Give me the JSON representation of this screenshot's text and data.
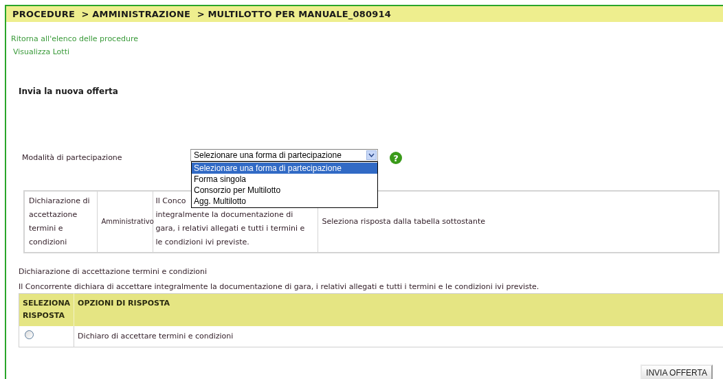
{
  "breadcrumb": "PROCEDURE  > AMMINISTRAZIONE  > MULTILOTTO PER MANUALE_080914",
  "links": [
    "Ritorna all'elenco delle procedure",
    "Visualizza Lotti"
  ],
  "section_title": "Invia la nuova offerta",
  "participation": {
    "label": "Modalità di partecipazione",
    "help": "?",
    "value": "Selezionare una forma di partecipazione",
    "expanded": true,
    "options": [
      {
        "label": "Selezionare una forma di partecipazione",
        "selected": true
      },
      {
        "label": "Forma singola",
        "selected": false
      },
      {
        "label": "Consorzio per Multilotto",
        "selected": false
      },
      {
        "label": "Agg. Multilotto",
        "selected": false
      }
    ]
  },
  "requirements_table": {
    "rows": [
      {
        "cells": [
          {
            "text": "Dichiarazione di accettazione termini e condizioni"
          },
          {
            "text": "Amministrativo"
          },
          {
            "lines": [
              "Il Conco",
              "integralmente la documentazione di",
              "gara, i relativi allegati e tutti i termini e",
              "le condizioni ivi previste."
            ]
          },
          {
            "text": "Seleziona risposta dalla tabella sottostante"
          }
        ]
      }
    ]
  },
  "declaration": {
    "title": "Dichiarazione di accettazione termini e condizioni",
    "description": "Il Concorrente dichiara di accettare integralmente la documentazione di gara, i relativi allegati e tutti i termini e le condizioni ivi previste."
  },
  "answers_table": {
    "columns": [
      "SELEZIONA RISPOSTA",
      "OPZIONI DI RISPOSTA"
    ],
    "rows": [
      {
        "selected": false,
        "label": "Dichiaro di accettare termini e condizioni"
      }
    ]
  },
  "submit_button": "INVIA OFFERTA"
}
